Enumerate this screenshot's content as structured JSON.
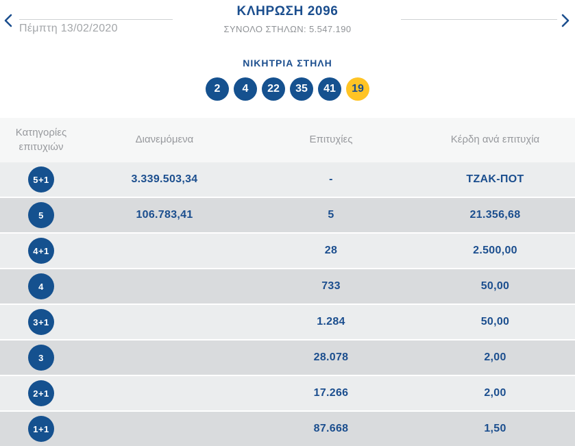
{
  "header": {
    "prev_icon": "chevron-left",
    "next_icon": "chevron-right",
    "date": "Πέμπτη 13/02/2020",
    "title": "ΚΛΗΡΩΣΗ 2096",
    "total_columns": "ΣΥΝΟΛΟ ΣΤΗΛΩΝ: 5.547.190"
  },
  "winning_numbers": {
    "label": "ΝΙΚΗΤΡΙΑ ΣΤΗΛΗ",
    "numbers": [
      "2",
      "4",
      "22",
      "35",
      "41"
    ],
    "joker": "19"
  },
  "table": {
    "columns": [
      "Κατηγορίες επιτυχιών",
      "Διανεμόμενα",
      "Επιτυχίες",
      "Κέρδη ανά επιτυχία"
    ],
    "rows": [
      {
        "category": "5+1",
        "distributed": "3.339.503,34",
        "winners": "-",
        "prize": "ΤΖΑΚ-ΠΟΤ"
      },
      {
        "category": "5",
        "distributed": "106.783,41",
        "winners": "5",
        "prize": "21.356,68"
      },
      {
        "category": "4+1",
        "distributed": "",
        "winners": "28",
        "prize": "2.500,00"
      },
      {
        "category": "4",
        "distributed": "",
        "winners": "733",
        "prize": "50,00"
      },
      {
        "category": "3+1",
        "distributed": "",
        "winners": "1.284",
        "prize": "50,00"
      },
      {
        "category": "3",
        "distributed": "",
        "winners": "28.078",
        "prize": "2,00"
      },
      {
        "category": "2+1",
        "distributed": "",
        "winners": "17.266",
        "prize": "2,00"
      },
      {
        "category": "1+1",
        "distributed": "",
        "winners": "87.668",
        "prize": "1,50"
      }
    ]
  },
  "colors": {
    "primary_blue": "#15518f",
    "title_blue": "#1b4e8e",
    "joker_yellow": "#ffc425",
    "row_light_gray": "#ebedee",
    "row_dark_gray": "#d9dbdd",
    "header_text_gray": "#97999d"
  }
}
